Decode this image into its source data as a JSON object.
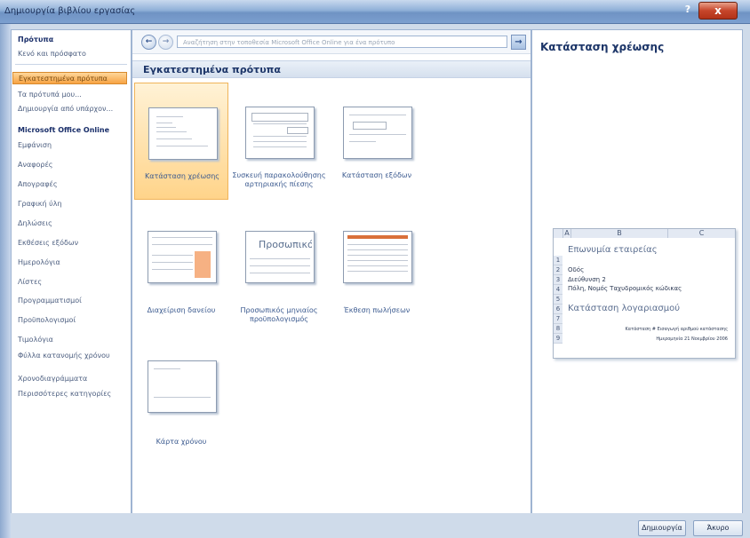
{
  "window": {
    "title": "Δημιουργία βιβλίου εργασίας",
    "help_glyph": "?",
    "close_glyph": "x"
  },
  "sidebar": {
    "items": [
      {
        "label": "Πρότυπα"
      },
      {
        "label": "Κενό και πρόσφατο"
      },
      {
        "label": "Εγκατεστημένα πρότυπα"
      },
      {
        "label": "Τα πρότυπά μου..."
      },
      {
        "label": "Δημιουργία από υπάρχον..."
      },
      {
        "label": "Microsoft Office Online"
      },
      {
        "label": "Εμφάνιση"
      },
      {
        "label": "Αναφορές"
      },
      {
        "label": "Απογραφές"
      },
      {
        "label": "Γραφική ύλη"
      },
      {
        "label": "Δηλώσεις"
      },
      {
        "label": "Εκθέσεις εξόδων"
      },
      {
        "label": "Ημερολόγια"
      },
      {
        "label": "Λίστες"
      },
      {
        "label": "Προγραμματισμοί"
      },
      {
        "label": "Προϋπολογισμοί"
      },
      {
        "label": "Τιμολόγια"
      },
      {
        "label": "Φύλλα κατανομής χρόνου"
      },
      {
        "label": "Χρονοδιαγράμματα"
      },
      {
        "label": "Περισσότερες κατηγορίες"
      }
    ]
  },
  "navbar": {
    "back_glyph": "←",
    "forward_glyph": "→",
    "search_placeholder": "Αναζήτηση στην τοποθεσία Microsoft Office Online για ένα πρότυπο",
    "go_glyph": "→"
  },
  "main": {
    "section_title": "Εγκατεστημένα πρότυπα",
    "templates": [
      {
        "label": "Κατάσταση χρέωσης"
      },
      {
        "label": "Συσκευή παρακολούθησης αρτηριακής πίεσης"
      },
      {
        "label": "Κατάσταση εξόδων"
      },
      {
        "label": "Διαχείριση δανείου"
      },
      {
        "label": "Προσωπικός μηνιαίος προϋπολογισμός",
        "thumb_text": "Προσωπικός μη"
      },
      {
        "label": "Έκθεση πωλήσεων"
      },
      {
        "label": "Κάρτα χρόνου"
      }
    ]
  },
  "preview": {
    "title": "Κατάσταση χρέωσης",
    "sheet": {
      "col_a": "A",
      "col_b": "B",
      "col_c": "C",
      "rows": [
        "1",
        "2",
        "3",
        "4",
        "5",
        "6",
        "7",
        "8",
        "9"
      ],
      "company": "Επωνυμία εταιρείας",
      "street": "Οδός",
      "line2": "Διεύθυνση 2",
      "city": "Πόλη, Νομός Ταχυδρομικός κώδικας",
      "doc_title": "Κατάσταση λογαριασμού",
      "statement_label": "Κατάσταση #",
      "statement_value": "Εισαγωγή αριθμού κατάστασης",
      "date_label": "Ημερομηνία",
      "date_value": "21 Νοεμβρίου 2006"
    }
  },
  "buttons": {
    "create": "Δημιουργία",
    "cancel": "Άκυρο"
  }
}
